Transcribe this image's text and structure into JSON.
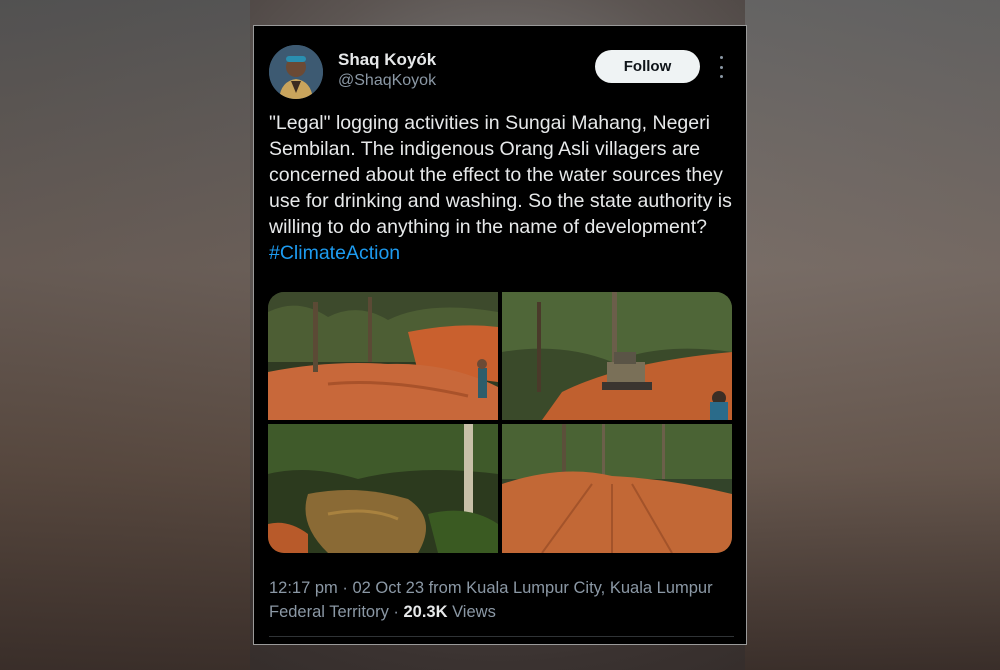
{
  "author": {
    "display_name": "Shaq Koyók",
    "handle": "@ShaqKoyok",
    "avatar_icon": "profile-photo"
  },
  "follow_label": "Follow",
  "more_icon": "more-options-vertical",
  "tweet": {
    "text": "\"Legal\" logging activities in Sungai Mahang, Negeri Sembilan. The indigenous Orang Asli villagers are concerned about the effect to the water sources they use for drinking and washing. So the state authority is willing to do anything in the name of development? ",
    "hashtag": "#ClimateAction"
  },
  "media": [
    {
      "subject": "dirt logging road with person in jungle"
    },
    {
      "subject": "bulldozer clearing forest"
    },
    {
      "subject": "muddy stream in forest"
    },
    {
      "subject": "cleared dirt road through forest"
    }
  ],
  "meta": {
    "timestamp": "12:17 pm · 02 Oct 23 from Kuala Lumpur City, Kuala Lumpur Federal Territory · ",
    "views_count": "20.3K",
    "views_label": " Views"
  },
  "colors": {
    "card_bg": "#000000",
    "text_primary": "#e7e9ea",
    "text_secondary": "#8b98a5",
    "hashtag": "#1d9bf0",
    "follow_bg": "#eff3f4"
  }
}
